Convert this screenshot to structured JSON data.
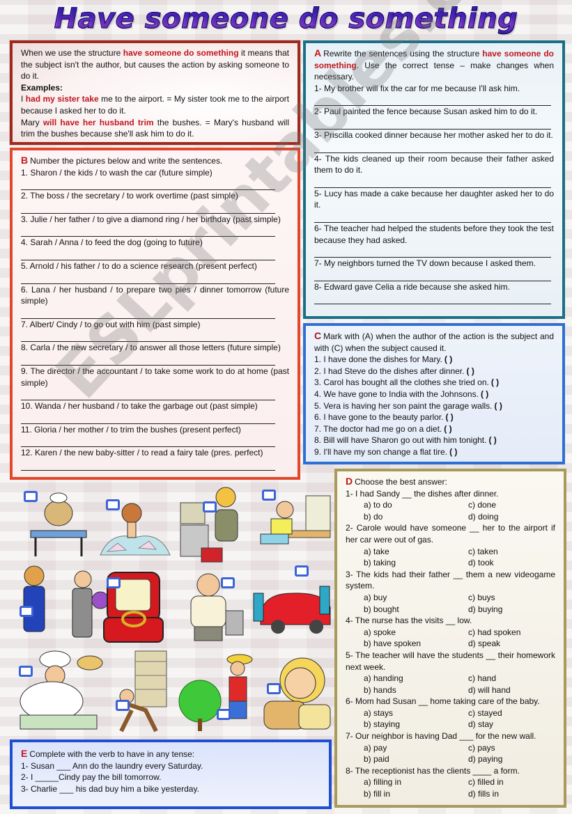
{
  "title": "Have someone do something",
  "watermark": "ESLprintables.com",
  "intro": {
    "p1_before": "When we use the structure ",
    "p1_hl": "have someone do something",
    "p1_after": " it means that the subject isn't the author, but causes the action by asking someone to do it.",
    "examples_label": "Examples:",
    "ex1_before": "I ",
    "ex1_hl": "had my sister take",
    "ex1_after": " me to the airport. = My sister took me to the airport because I asked her to do it.",
    "ex2_before": "Mary ",
    "ex2_hl": "will have her husband trim",
    "ex2_after": " the bushes. = Mary's husband will trim the bushes because she'll ask him to do it."
  },
  "sectionA": {
    "letter": "A",
    "instr_before": "Rewrite the sentences using the structure ",
    "instr_hl": "have someone do something",
    "instr_after": ". Use the correct tense – make changes when necessary.",
    "items": [
      "1- My brother will fix the car for me because I'll ask him.",
      "2- Paul painted the fence because Susan asked him to do it.",
      "3- Priscilla cooked dinner because her mother asked her to do it.",
      "4- The kids cleaned up their room because their father asked them to do it.",
      "5- Lucy has made a cake because her daughter asked her to do it.",
      "6- The teacher had helped the students before they took the test because they had asked.",
      "7- My neighbors turned the TV down because I asked them.",
      "8- Edward gave Celia a ride because she asked him."
    ]
  },
  "sectionB": {
    "letter": "B",
    "instr": "Number the pictures below and write the sentences.",
    "items": [
      "1. Sharon / the kids / to wash the car (future simple)",
      "2. The boss / the secretary / to work overtime (past simple)",
      "3. Julie / her father / to give a diamond ring / her birthday (past simple)",
      "4. Sarah / Anna / to feed the dog (going to future)",
      "5. Arnold / his father / to do a science research (present perfect)",
      "6. Lana / her husband / to prepare two pies / dinner tomorrow (future simple)",
      "7. Albert/ Cindy / to go out with him (past simple)",
      "8. Carla / the new secretary / to answer all those letters (future simple)",
      "9. The director / the accountant / to take some work to do at home (past simple)",
      "10. Wanda / her husband / to take the garbage out (past simple)",
      "11. Gloria / her mother / to trim the bushes (present perfect)",
      "12. Karen / the new baby-sitter / to read a fairy tale (pres. perfect)"
    ]
  },
  "sectionC": {
    "letter": "C",
    "instr": "Mark with (A) when the author of the action is the subject and with (C) when the subject caused it.",
    "paren": "(   )",
    "items": [
      "1. I have done the dishes for Mary.",
      "2. I had Steve do the dishes after dinner.",
      "3. Carol has bought all the clothes she tried on.",
      "4. We have gone to India with the Johnsons.",
      "5. Vera is having her son paint the garage walls.",
      "6. I have gone to the beauty parlor.",
      "7. The doctor had me go on a diet.",
      "8. Bill will have Sharon go out with him tonight.",
      "9. I'll have my son change a flat tire."
    ]
  },
  "sectionD": {
    "letter": "D",
    "instr": "Choose the best answer:",
    "questions": [
      {
        "q": "1- I had Sandy __ the dishes after dinner.",
        "a": "a)   to do",
        "b": "b)   do",
        "c": "c) done",
        "d": "d) doing"
      },
      {
        "q": "2- Carole would have someone __ her to the airport if her car were out of gas.",
        "a": "a)   take",
        "b": "b)   taking",
        "c": "c) taken",
        "d": "d) took"
      },
      {
        "q": "3- The kids had their father __ them a new videogame system.",
        "a": "a)   buy",
        "b": "b)   bought",
        "c": "c) buys",
        "d": "d) buying"
      },
      {
        "q": "4- The nurse has the visits __ low.",
        "a": "a)   spoke",
        "b": "b)   have spoken",
        "c": "c) had spoken",
        "d": "d) speak"
      },
      {
        "q": "5- The teacher will have the students __ their homework next week.",
        "a": "a)   handing",
        "b": "b)   hands",
        "c": "c) hand",
        "d": "d) will hand"
      },
      {
        "q": "6- Mom had Susan __ home taking care of the baby.",
        "a": "a)   stays",
        "b": "b)   staying",
        "c": "c) stayed",
        "d": "d) stay"
      },
      {
        "q": "7- Our neighbor is having Dad ___ for the new wall.",
        "a": "a)   pay",
        "b": "b)   paid",
        "c": "c) pays",
        "d": "d) paying"
      },
      {
        "q": "8- The receptionist has the clients ____ a form.",
        "a": "a)   filling in",
        "b": "b)   fill in",
        "c": "c) filled in",
        "d": "d) fills in"
      }
    ]
  },
  "sectionE": {
    "letter": "E",
    "instr": "Complete with the verb to have in any tense:",
    "items": [
      "1- Susan ___ Ann do the laundry every Saturday.",
      "2- I _____Cindy pay the bill tomorrow.",
      "3- Charlie ___ his dad buy him a bike yesterday."
    ]
  },
  "pictures": [
    "dog-at-table",
    "woman-with-letters",
    "secretary-on-phone",
    "man-at-computer",
    "couple-with-flowers",
    "diamond-ring-box",
    "boss-with-garbage",
    "kids-washing-car",
    "chef-with-pies",
    "old-man-with-books",
    "woman-trimming-bush",
    "girl-in-chair"
  ]
}
